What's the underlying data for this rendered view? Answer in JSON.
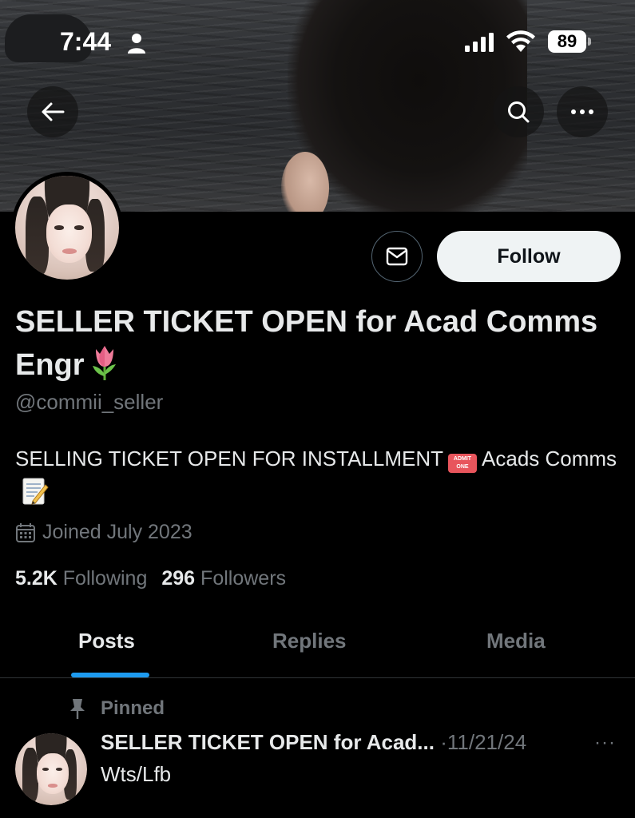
{
  "status_bar": {
    "time": "7:44",
    "battery": "89"
  },
  "profile": {
    "display_name": "SELLER TICKET OPEN for Acad Comms Engr",
    "handle": "@commii_seller",
    "bio_part1": "SELLING TICKET OPEN FOR INSTALLMENT",
    "bio_ticket_text": "ADMIT ONE",
    "bio_part2": "Acads Comms",
    "joined": "Joined July 2023",
    "following_count": "5.2K",
    "following_label": "Following",
    "followers_count": "296",
    "followers_label": "Followers",
    "follow_button": "Follow"
  },
  "tabs": [
    {
      "label": "Posts",
      "active": true
    },
    {
      "label": "Replies",
      "active": false
    },
    {
      "label": "Media",
      "active": false
    }
  ],
  "pinned_post": {
    "pinned_label": "Pinned",
    "author": "SELLER TICKET OPEN for Acad...",
    "date": "11/21/24",
    "text": "Wts/Lfb",
    "more": "···"
  },
  "icons": {
    "back": "arrow-left-icon",
    "search": "search-icon",
    "more": "more-dots-icon",
    "message": "envelope-icon",
    "calendar": "calendar-icon",
    "pin": "pin-icon"
  },
  "colors": {
    "accent": "#1d9bf0",
    "muted": "#71767b",
    "text": "#e7e9ea",
    "background": "#000000"
  }
}
